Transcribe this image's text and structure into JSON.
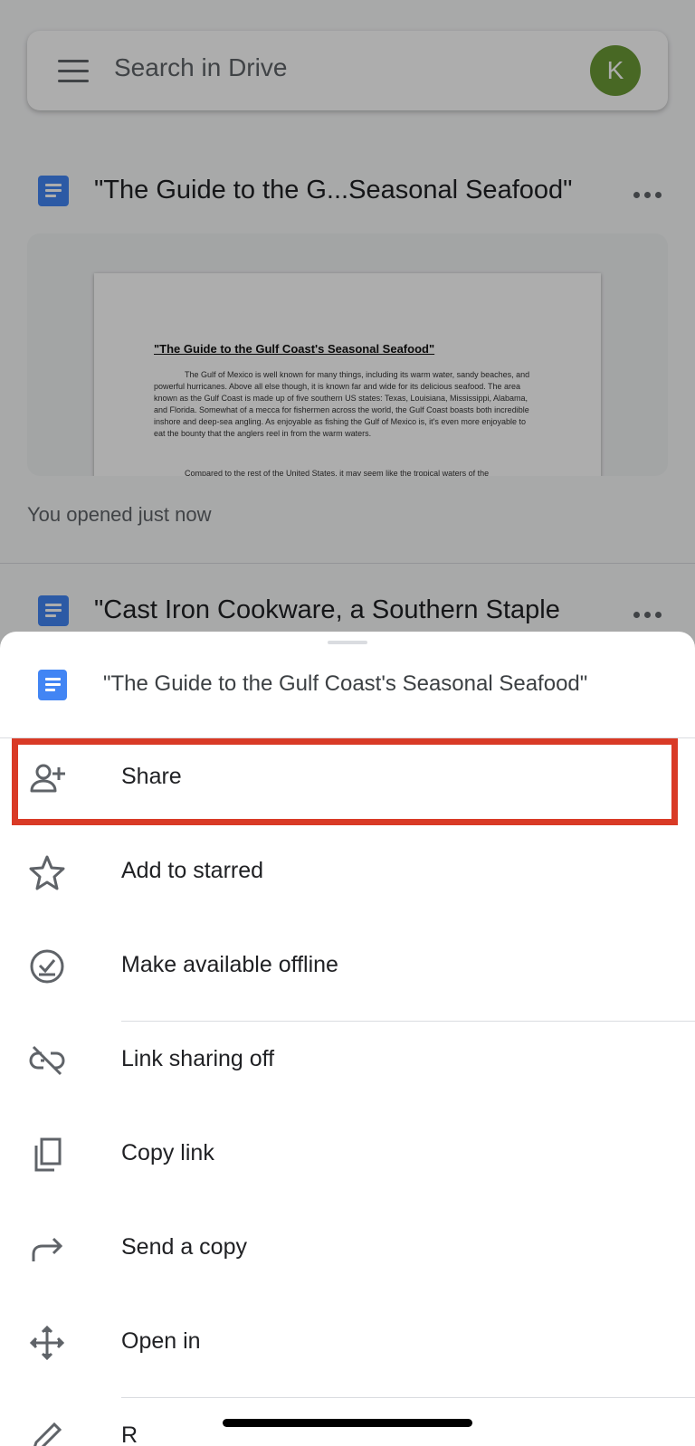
{
  "background": {
    "search": {
      "placeholder": "Search in Drive",
      "avatar_initial": "K",
      "avatar_color": "#6a9a36"
    },
    "files": [
      {
        "title": "\"The Guide to the G...Seasonal Seafood\""
      },
      {
        "title": "\"Cast Iron Cookware, a Southern Staple"
      }
    ],
    "preview": {
      "heading": "\"The Guide to the Gulf Coast's Seasonal Seafood\"",
      "body": "The Gulf of Mexico is well known for many things, including its warm water, sandy beaches, and powerful hurricanes. Above all else though, it is known far and wide for its delicious seafood. The area known as the Gulf Coast is made up of five southern US states: Texas, Louisiana, Mississippi, Alabama, and Florida. Somewhat of a mecca for fishermen across the world, the Gulf Coast boasts both incredible inshore and deep-sea angling. As enjoyable as fishing the Gulf of Mexico is, it's even more enjoyable to eat the bounty that the anglers reel in from the warm waters.",
      "body2": "Compared to the rest of the United States, it may seem like the tropical waters of the"
    },
    "opened_label": "You opened just now"
  },
  "sheet": {
    "title": "\"The Guide to the Gulf Coast's Seasonal Seafood\"",
    "items": [
      {
        "label": "Share",
        "icon": "person-add-icon"
      },
      {
        "label": "Add to starred",
        "icon": "star-icon"
      },
      {
        "label": "Make available offline",
        "icon": "offline-check-icon"
      },
      {
        "label": "Link sharing off",
        "icon": "link-off-icon"
      },
      {
        "label": "Copy link",
        "icon": "copy-icon"
      },
      {
        "label": "Send a copy",
        "icon": "send-arrow-icon"
      },
      {
        "label": "Open in",
        "icon": "move-arrows-icon"
      },
      {
        "label": "R",
        "icon": "pencil-icon"
      }
    ],
    "highlight_color": "#d93a26"
  }
}
